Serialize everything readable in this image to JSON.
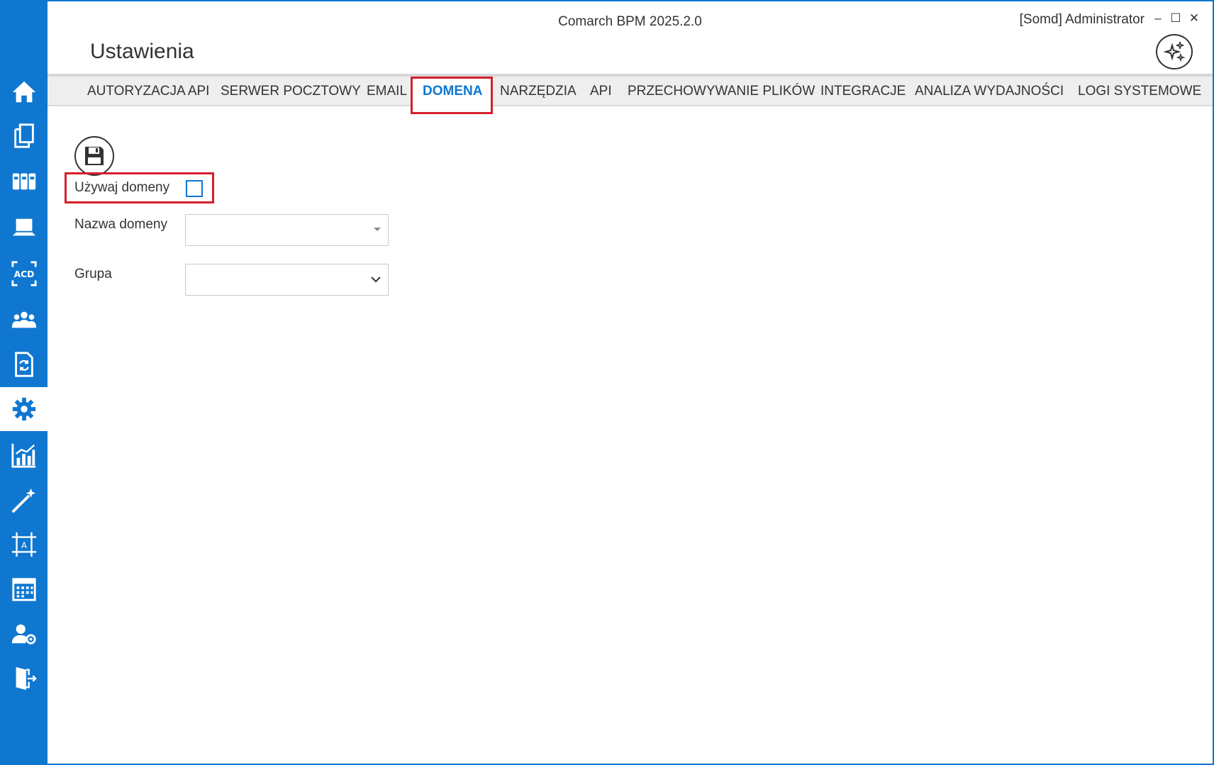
{
  "window": {
    "app_title": "Comarch BPM 2025.2.0",
    "user": "[Somd] Administrator",
    "minimize": "–",
    "maximize": "☐",
    "close": "✕"
  },
  "page": {
    "title": "Ustawienia"
  },
  "sidebar": {
    "items": [
      {
        "icon": "home-icon"
      },
      {
        "icon": "documents-icon"
      },
      {
        "icon": "binders-icon"
      },
      {
        "icon": "laptop-icon"
      },
      {
        "icon": "acd-icon"
      },
      {
        "icon": "users-icon"
      },
      {
        "icon": "document-sync-icon"
      },
      {
        "icon": "gear-icon",
        "active": true
      },
      {
        "icon": "chart-icon"
      },
      {
        "icon": "magic-wand-icon"
      },
      {
        "icon": "designer-icon"
      },
      {
        "icon": "calendar-icon"
      },
      {
        "icon": "user-settings-icon"
      },
      {
        "icon": "logout-icon"
      }
    ]
  },
  "tabs": [
    {
      "label": "AUTORYZACJA API"
    },
    {
      "label": "SERWER POCZTOWY"
    },
    {
      "label": "EMAIL"
    },
    {
      "label": "DOMENA",
      "active": true
    },
    {
      "label": "NARZĘDZIA"
    },
    {
      "label": "API"
    },
    {
      "label": "PRZECHOWYWANIE PLIKÓW"
    },
    {
      "label": "INTEGRACJE"
    },
    {
      "label": "ANALIZA WYDAJNOŚCI"
    },
    {
      "label": "LOGI SYSTEMOWE"
    }
  ],
  "form": {
    "use_domain_label": "Używaj domeny",
    "use_domain_checked": false,
    "domain_name_label": "Nazwa domeny",
    "domain_name_value": "",
    "group_label": "Grupa",
    "group_value": ""
  },
  "colors": {
    "accent": "#0f77d0",
    "highlight": "#d61f2b",
    "tab_bar": "#eeeeee"
  }
}
